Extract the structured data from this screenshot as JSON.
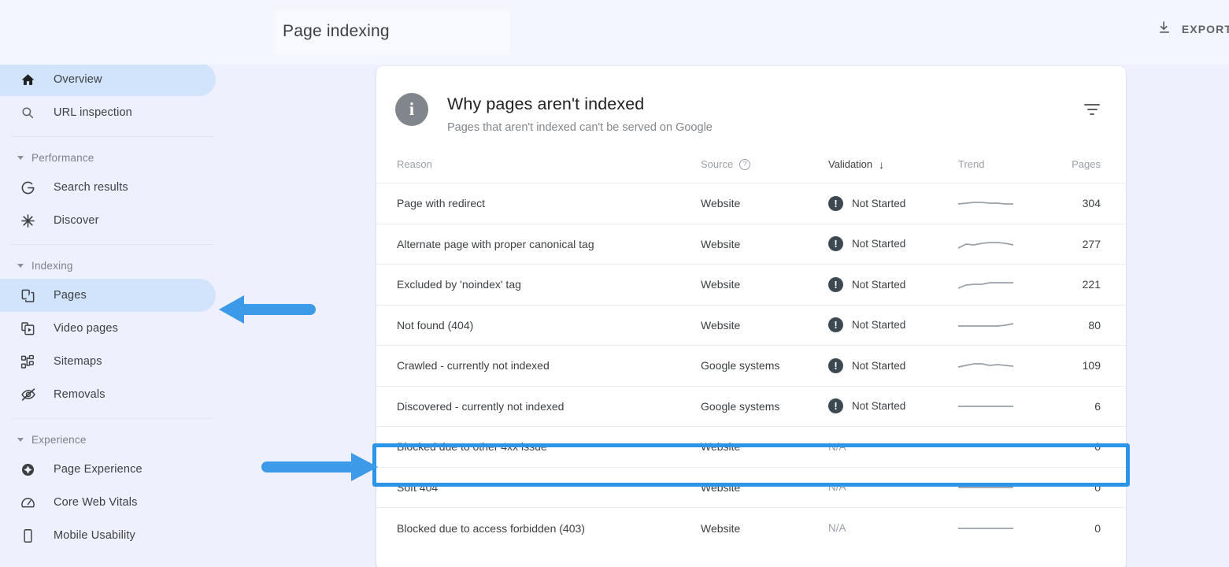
{
  "topbar": {
    "title": "Page indexing",
    "export_label": "EXPORT",
    "export_icon": "download-icon"
  },
  "sidebar": {
    "property_selector": {
      "value": "",
      "redacted": true,
      "chevron_icon": "chevron-down-icon"
    },
    "items": [
      {
        "type": "item",
        "label": "Overview",
        "icon": "home-icon",
        "active": true
      },
      {
        "type": "item",
        "label": "URL inspection",
        "icon": "search-icon",
        "active": false
      },
      {
        "type": "separator"
      },
      {
        "type": "group",
        "label": "Performance",
        "icon": "caret-down-icon"
      },
      {
        "type": "item",
        "label": "Search results",
        "icon": "google-g-icon",
        "active": false
      },
      {
        "type": "item",
        "label": "Discover",
        "icon": "discover-icon",
        "active": false
      },
      {
        "type": "separator"
      },
      {
        "type": "group",
        "label": "Indexing",
        "icon": "caret-down-icon"
      },
      {
        "type": "item",
        "label": "Pages",
        "icon": "pages-icon",
        "active": true
      },
      {
        "type": "item",
        "label": "Video pages",
        "icon": "video-pages-icon",
        "active": false
      },
      {
        "type": "item",
        "label": "Sitemaps",
        "icon": "sitemaps-icon",
        "active": false
      },
      {
        "type": "item",
        "label": "Removals",
        "icon": "removals-icon",
        "active": false
      },
      {
        "type": "separator"
      },
      {
        "type": "group",
        "label": "Experience",
        "icon": "caret-down-icon"
      },
      {
        "type": "item",
        "label": "Page Experience",
        "icon": "page-experience-icon",
        "active": false
      },
      {
        "type": "item",
        "label": "Core Web Vitals",
        "icon": "core-web-vitals-icon",
        "active": false
      },
      {
        "type": "item",
        "label": "Mobile Usability",
        "icon": "mobile-usability-icon",
        "active": false
      }
    ]
  },
  "card": {
    "info_icon": "info-icon",
    "title": "Why pages aren't indexed",
    "subtitle": "Pages that aren't indexed can't be served on Google",
    "filter_icon": "filter-icon",
    "columns": [
      {
        "key": "reason",
        "label": "Reason"
      },
      {
        "key": "source",
        "label": "Source",
        "help_icon": "help-icon"
      },
      {
        "key": "validation",
        "label": "Validation",
        "sort_icon": "sort-desc-arrow-icon",
        "sorted": true
      },
      {
        "key": "trend",
        "label": "Trend"
      },
      {
        "key": "pages",
        "label": "Pages"
      }
    ],
    "rows": [
      {
        "reason": "Page with redirect",
        "source": "Website",
        "validation": "Not Started",
        "validation_icon": "alert-icon",
        "pages": "304",
        "highlighted": false
      },
      {
        "reason": "Alternate page with proper canonical tag",
        "source": "Website",
        "validation": "Not Started",
        "validation_icon": "alert-icon",
        "pages": "277",
        "highlighted": false
      },
      {
        "reason": "Excluded by 'noindex' tag",
        "source": "Website",
        "validation": "Not Started",
        "validation_icon": "alert-icon",
        "pages": "221",
        "highlighted": false
      },
      {
        "reason": "Not found (404)",
        "source": "Website",
        "validation": "Not Started",
        "validation_icon": "alert-icon",
        "pages": "80",
        "highlighted": false
      },
      {
        "reason": "Crawled - currently not indexed",
        "source": "Google systems",
        "validation": "Not Started",
        "validation_icon": "alert-icon",
        "pages": "109",
        "highlighted": false
      },
      {
        "reason": "Discovered - currently not indexed",
        "source": "Google systems",
        "validation": "Not Started",
        "validation_icon": "alert-icon",
        "pages": "6",
        "highlighted": false
      },
      {
        "reason": "Blocked due to other 4xx issue",
        "source": "Website",
        "validation": "N/A",
        "validation_icon": null,
        "pages": "0",
        "highlighted": true
      },
      {
        "reason": "Soft 404",
        "source": "Website",
        "validation": "N/A",
        "validation_icon": null,
        "pages": "0",
        "highlighted": false
      },
      {
        "reason": "Blocked due to access forbidden (403)",
        "source": "Website",
        "validation": "N/A",
        "validation_icon": null,
        "pages": "0",
        "highlighted": false
      }
    ]
  },
  "chart_data": {
    "type": "table",
    "title": "Why pages aren't indexed",
    "columns": [
      "Reason",
      "Source",
      "Validation",
      "Trend",
      "Pages"
    ],
    "categories": [
      "Page with redirect",
      "Alternate page with proper canonical tag",
      "Excluded by 'noindex' tag",
      "Not found (404)",
      "Crawled - currently not indexed",
      "Discovered - currently not indexed",
      "Blocked due to other 4xx issue",
      "Soft 404",
      "Blocked due to access forbidden (403)"
    ],
    "values": [
      304,
      277,
      221,
      80,
      109,
      6,
      0,
      0,
      0
    ],
    "ylabel": "Pages",
    "sparklines": [
      {
        "name": "Page with redirect",
        "points": [
          12,
          11,
          10,
          10,
          11,
          11,
          12,
          12
        ]
      },
      {
        "name": "Alternate page with proper canonical tag",
        "points": [
          16,
          11,
          12,
          10,
          9,
          9,
          10,
          12
        ]
      },
      {
        "name": "Excluded by 'noindex' tag",
        "points": [
          16,
          12,
          11,
          11,
          9,
          9,
          9,
          9
        ]
      },
      {
        "name": "Not found (404)",
        "points": [
          12,
          12,
          12,
          12,
          12,
          12,
          11,
          9
        ]
      },
      {
        "name": "Crawled - currently not indexed",
        "points": [
          13,
          11,
          9,
          9,
          11,
          10,
          11,
          12
        ]
      },
      {
        "name": "Discovered - currently not indexed",
        "points": [
          11,
          11,
          11,
          11,
          11,
          11,
          11,
          11
        ]
      },
      {
        "name": "Blocked due to other 4xx issue",
        "points": [
          11,
          11,
          11,
          11,
          11,
          11,
          11,
          11
        ]
      },
      {
        "name": "Soft 404",
        "points": [
          11,
          11,
          11,
          11,
          11,
          11,
          11,
          11
        ]
      },
      {
        "name": "Blocked due to access forbidden (403)",
        "points": [
          11,
          11,
          11,
          11,
          11,
          11,
          11,
          11
        ]
      }
    ]
  },
  "annotations": {
    "arrow_sidebar": {
      "icon": "arrow-left-icon",
      "color": "#3c9ae8",
      "points_to": "Pages"
    },
    "arrow_row": {
      "icon": "arrow-right-icon",
      "color": "#3c9ae8",
      "points_to": "Blocked due to other 4xx issue"
    },
    "highlight_box": {
      "color": "#2d95e8",
      "target": "Blocked due to other 4xx issue"
    }
  }
}
